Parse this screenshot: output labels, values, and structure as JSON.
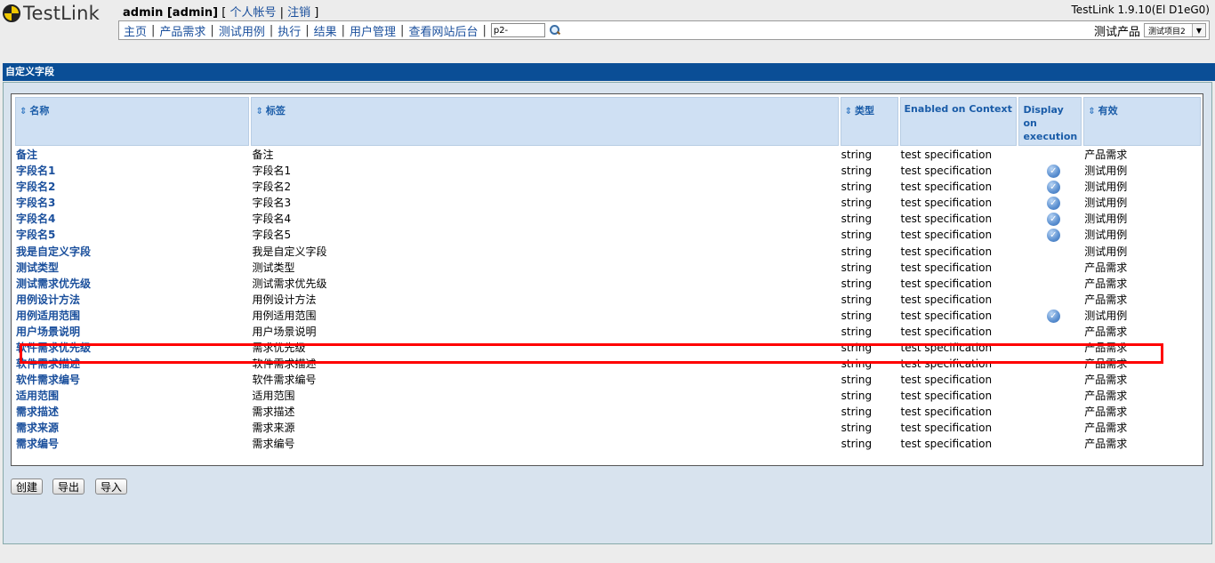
{
  "header": {
    "logo_text": "TestLink",
    "user": "admin [admin]",
    "bracket_open": "[",
    "bracket_close": "]",
    "personal_account": "个人帐号",
    "logout": "注销",
    "separator": "|",
    "version": "TestLink 1.9.10(El D1eG0)"
  },
  "nav": {
    "items": [
      "主页",
      "产品需求",
      "测试用例",
      "执行",
      "结果",
      "用户管理",
      "查看网站后台"
    ],
    "search_value": "p2-",
    "product_label": "测试产品",
    "product_selected": "测试项目2"
  },
  "page": {
    "title": "自定义字段"
  },
  "table": {
    "headers": {
      "name": "名称",
      "label": "标签",
      "type": "类型",
      "context": "Enabled on Context",
      "display": "Display on execution",
      "active": "有效"
    },
    "rows": [
      {
        "name": "备注",
        "label": "备注",
        "type": "string",
        "context": "test specification",
        "display": false,
        "active": "产品需求"
      },
      {
        "name": "字段名1",
        "label": "字段名1",
        "type": "string",
        "context": "test specification",
        "display": true,
        "active": "测试用例"
      },
      {
        "name": "字段名2",
        "label": "字段名2",
        "type": "string",
        "context": "test specification",
        "display": true,
        "active": "测试用例"
      },
      {
        "name": "字段名3",
        "label": "字段名3",
        "type": "string",
        "context": "test specification",
        "display": true,
        "active": "测试用例"
      },
      {
        "name": "字段名4",
        "label": "字段名4",
        "type": "string",
        "context": "test specification",
        "display": true,
        "active": "测试用例"
      },
      {
        "name": "字段名5",
        "label": "字段名5",
        "type": "string",
        "context": "test specification",
        "display": true,
        "active": "测试用例"
      },
      {
        "name": "我是自定义字段",
        "label": "我是自定义字段",
        "type": "string",
        "context": "test specification",
        "display": false,
        "active": "测试用例",
        "highlight": true
      },
      {
        "name": "测试类型",
        "label": "测试类型",
        "type": "string",
        "context": "test specification",
        "display": false,
        "active": "产品需求"
      },
      {
        "name": "测试需求优先级",
        "label": "测试需求优先级",
        "type": "string",
        "context": "test specification",
        "display": false,
        "active": "产品需求"
      },
      {
        "name": "用例设计方法",
        "label": "用例设计方法",
        "type": "string",
        "context": "test specification",
        "display": false,
        "active": "产品需求"
      },
      {
        "name": "用例适用范围",
        "label": "用例适用范围",
        "type": "string",
        "context": "test specification",
        "display": true,
        "active": "测试用例"
      },
      {
        "name": "用户场景说明",
        "label": "用户场景说明",
        "type": "string",
        "context": "test specification",
        "display": false,
        "active": "产品需求"
      },
      {
        "name": "软件需求优先级",
        "label": "需求优先级",
        "type": "string",
        "context": "test specification",
        "display": false,
        "active": "产品需求"
      },
      {
        "name": "软件需求描述",
        "label": "软件需求描述",
        "type": "string",
        "context": "test specification",
        "display": false,
        "active": "产品需求"
      },
      {
        "name": "软件需求编号",
        "label": "软件需求编号",
        "type": "string",
        "context": "test specification",
        "display": false,
        "active": "产品需求"
      },
      {
        "name": "适用范围",
        "label": "适用范围",
        "type": "string",
        "context": "test specification",
        "display": false,
        "active": "产品需求"
      },
      {
        "name": "需求描述",
        "label": "需求描述",
        "type": "string",
        "context": "test specification",
        "display": false,
        "active": "产品需求"
      },
      {
        "name": "需求来源",
        "label": "需求来源",
        "type": "string",
        "context": "test specification",
        "display": false,
        "active": "产品需求"
      },
      {
        "name": "需求编号",
        "label": "需求编号",
        "type": "string",
        "context": "test specification",
        "display": false,
        "active": "产品需求"
      }
    ]
  },
  "buttons": {
    "create": "创建",
    "export": "导出",
    "import": "导入"
  },
  "colors": {
    "accent": "#0a4e96",
    "highlight": "#ff0000",
    "link": "#1a4f9c"
  }
}
